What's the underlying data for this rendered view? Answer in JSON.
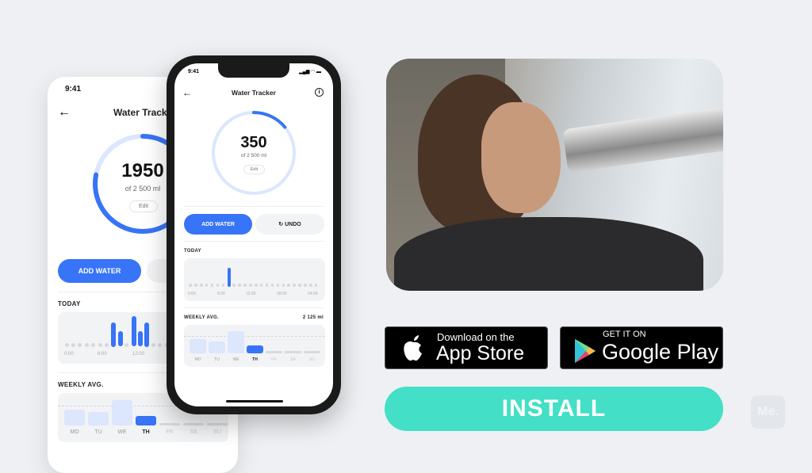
{
  "back_phone": {
    "time": "9:41",
    "title": "Water Tracker",
    "amount": "1950",
    "goal": "of 2 500 ml",
    "edit": "Edit",
    "add_water": "ADD WATER",
    "today_label": "TODAY",
    "axis": [
      "0:00",
      "6:00",
      "12:00"
    ],
    "weekly_label": "WEEKLY AVG.",
    "days": [
      "MO",
      "TU",
      "WE",
      "TH",
      "FR",
      "SA",
      "SU"
    ],
    "today_hours": [
      0,
      0,
      0,
      0,
      0,
      0,
      0,
      1,
      0.6,
      0,
      1.3,
      0.6,
      1,
      0,
      0,
      0,
      1,
      0,
      0,
      0,
      0,
      0,
      0,
      0,
      0
    ],
    "progress": 0.78
  },
  "front_phone": {
    "time": "9:41",
    "title": "Water Tracker",
    "amount": "350",
    "goal": "of 2 500 ml",
    "edit": "Edit",
    "add_water": "ADD WATER",
    "undo": "UNDO",
    "today_label": "TODAY",
    "axis": [
      "0:00",
      "6:00",
      "12:00",
      "18:00",
      "24:00"
    ],
    "weekly_label": "WEEKLY AVG.",
    "weekly_value": "2 125 ml",
    "days": [
      "MO",
      "TU",
      "WE",
      "TH",
      "FR",
      "SA",
      "SU"
    ],
    "today_hours": [
      0,
      0,
      0,
      0,
      0,
      0,
      0,
      1,
      0,
      0,
      0,
      0,
      0,
      0,
      0,
      0,
      0,
      0,
      0,
      0,
      0,
      0,
      0,
      0
    ],
    "progress": 0.14
  },
  "weekly_values": [
    0.64,
    0.52,
    1.0,
    0.37,
    0,
    0,
    0
  ],
  "current_day_index": 3,
  "app_store": {
    "small": "Download on the",
    "big": "App Store"
  },
  "google_play": {
    "small": "GET IT ON",
    "big": "Google Play"
  },
  "install": "INSTALL",
  "logo": "Me.",
  "colors": {
    "accent": "#3774f7",
    "ring": "#dce6fd",
    "install": "#43dfc6"
  }
}
